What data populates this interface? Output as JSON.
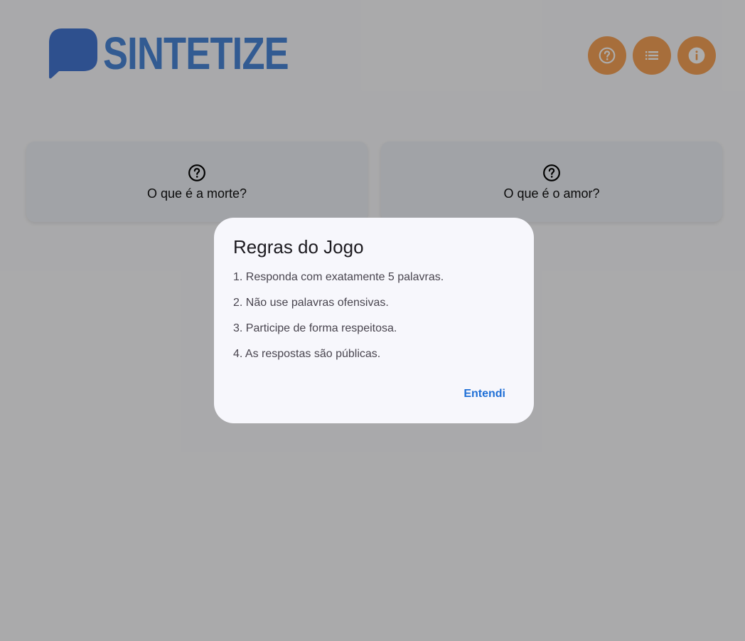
{
  "header": {
    "logo_text": "SINTETIZE",
    "actions": [
      {
        "name": "help",
        "icon": "help-circle-icon"
      },
      {
        "name": "list",
        "icon": "list-icon"
      },
      {
        "name": "info",
        "icon": "info-icon"
      }
    ]
  },
  "cards": [
    {
      "icon": "question-circle-icon",
      "title": "O que é a morte?"
    },
    {
      "icon": "question-circle-icon",
      "title": "O que é o amor?"
    }
  ],
  "dialog": {
    "title": "Regras do Jogo",
    "rules": [
      "1. Responda com exatamente 5 palavras.",
      "2. Não use palavras ofensivas.",
      "3. Participe de forma respeitosa.",
      "4. As respostas são públicas."
    ],
    "confirm_label": "Entendi"
  },
  "colors": {
    "brand_blue": "#4a86d8",
    "action_orange": "#f7a257",
    "dialog_accent": "#1f6fd6",
    "scrim": "rgba(0,0,0,0.32)"
  }
}
